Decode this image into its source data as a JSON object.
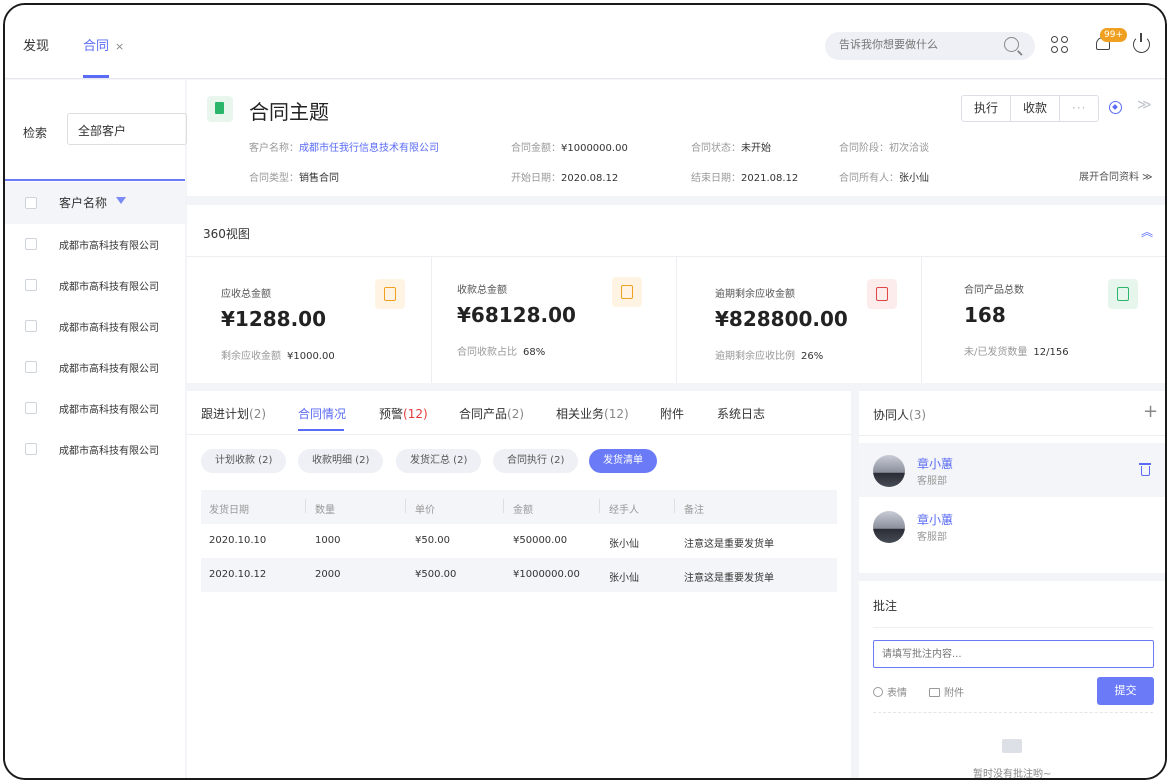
{
  "topbar": {
    "discover": "发现",
    "active_tab": "合同",
    "close_symbol": "×",
    "search_placeholder": "告诉我你想要做什么",
    "badge": "99+"
  },
  "left_panel": {
    "search_label": "检索",
    "filter_value": "全部客户",
    "column_header": "客户名称",
    "rows": [
      "成都市高科技有限公司",
      "成都市高科技有限公司",
      "成都市高科技有限公司",
      "成都市高科技有限公司",
      "成都市高科技有限公司",
      "成都市高科技有限公司"
    ]
  },
  "contract": {
    "title": "合同主题",
    "customer_label": "客户名称：",
    "customer_value": "成都市任我行信息技术有限公司",
    "amount_label": "合同金额：",
    "amount_value": "¥1000000.00",
    "status_label": "合同状态：",
    "status_value": "未开始",
    "stage_label": "合同阶段：",
    "stage_value": "初次洽谈",
    "type_label": "合同类型：",
    "type_value": "销售合同",
    "start_label": "开始日期：",
    "start_value": "2020.08.12",
    "end_label": "结束日期：",
    "end_value": "2021.08.12",
    "owner_label": "合同所有人：",
    "owner_value": "张小仙",
    "actions": {
      "execute": "执行",
      "collect": "收款",
      "more": "···"
    },
    "expand_label": "展开合同资料 ≫"
  },
  "view360": {
    "title": "360视图",
    "collapse_symbol": "≪",
    "stats": [
      {
        "label": "应收总金额",
        "value": "¥1288.00",
        "sub_label": "剩余应收金额",
        "sub_value": "¥1000.00",
        "color": "#f0a020",
        "bg": "#fff3e3"
      },
      {
        "label": "收款总金额",
        "value": "¥68128.00",
        "sub_label": "合同收款占比",
        "sub_value": "68%",
        "color": "#f0a020",
        "bg": "#fff3e3"
      },
      {
        "label": "逾期剩余应收金额",
        "value": "¥828800.00",
        "sub_label": "逾期剩余应收比例",
        "sub_value": "26%",
        "color": "#e04646",
        "bg": "#fdecec"
      },
      {
        "label": "合同产品总数",
        "value": "168",
        "sub_label": "未/已发货数量",
        "sub_value": "12/156",
        "color": "#2bb56b",
        "bg": "#e6f6ec"
      }
    ]
  },
  "detail": {
    "tabs": [
      {
        "label": "跟进计划",
        "count": "(2)"
      },
      {
        "label": "合同情况",
        "count": ""
      },
      {
        "label": "预警",
        "count": "(12)"
      },
      {
        "label": "合同产品",
        "count": "(2)"
      },
      {
        "label": "相关业务",
        "count": "(12)"
      },
      {
        "label": "附件",
        "count": ""
      },
      {
        "label": "系统日志",
        "count": ""
      }
    ],
    "pills": [
      "计划收款 (2)",
      "收款明细 (2)",
      "发货汇总 (2)",
      "合同执行 (2)",
      "发货清单"
    ],
    "table": {
      "headers": [
        "发货日期",
        "数量",
        "单价",
        "金额",
        "经手人",
        "备注"
      ],
      "rows": [
        [
          "2020.10.10",
          "1000",
          "¥50.00",
          "¥50000.00",
          "张小仙",
          "注意这是重要发货单"
        ],
        [
          "2020.10.12",
          "2000",
          "¥500.00",
          "¥1000000.00",
          "张小仙",
          "注意这是重要发货单"
        ]
      ]
    }
  },
  "collaborators": {
    "title": "协同人",
    "count": "(3)",
    "add_symbol": "+",
    "people": [
      {
        "name": "章小蕙",
        "dept": "客服部"
      },
      {
        "name": "章小蕙",
        "dept": "客服部"
      }
    ]
  },
  "comments": {
    "title": "批注",
    "placeholder": "请填写批注内容...",
    "emoji_label": "表情",
    "attach_label": "附件",
    "submit_label": "提交",
    "empty_text": "暂时没有批注哟~"
  }
}
